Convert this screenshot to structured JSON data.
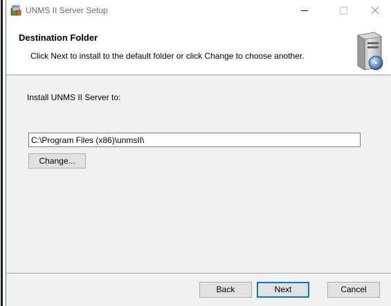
{
  "window": {
    "title": "UNMS II Server Setup"
  },
  "header": {
    "title": "Destination Folder",
    "subtitle": "Click Next to install to the default folder or click Change to choose another.",
    "icon": "computer-disc-icon"
  },
  "main": {
    "install_label": "Install UNMS II Server to:",
    "path_value": "C:\\Program Files (x86)\\unmsII\\",
    "change_label": "Change..."
  },
  "footer": {
    "back_label": "Back",
    "next_label": "Next",
    "cancel_label": "Cancel"
  },
  "colors": {
    "accent": "#0078d7",
    "dialog_bg": "#f0f0f0"
  }
}
